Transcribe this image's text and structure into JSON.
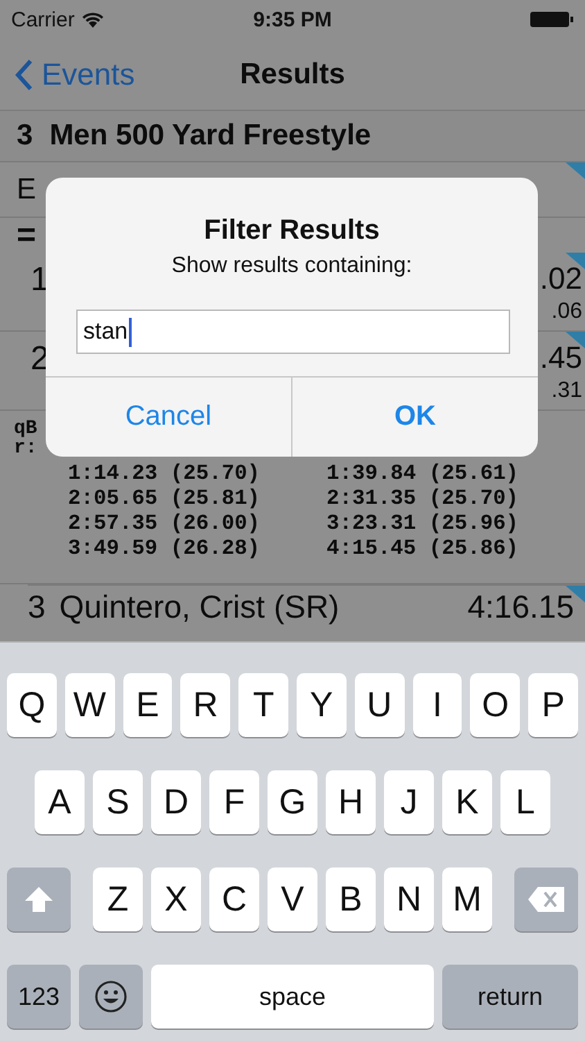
{
  "status_bar": {
    "carrier": "Carrier",
    "time": "9:35 PM"
  },
  "nav": {
    "back": "Events",
    "title": "Results"
  },
  "event_header": {
    "number": "3",
    "name": "Men 500 Yard Freestyle"
  },
  "list": [
    {
      "kind": "label",
      "text": "E",
      "flagged": true
    },
    {
      "kind": "separator",
      "text": "="
    },
    {
      "kind": "result",
      "place": "1",
      "time": ".02",
      "split": ".06",
      "flagged": true
    },
    {
      "kind": "result",
      "place": "2",
      "time": ".45",
      "split": ".31",
      "flagged": true
    },
    {
      "kind": "code",
      "lines": [
        "qB",
        "r:"
      ]
    },
    {
      "kind": "splits",
      "rows": [
        [
          "1:14.23 (25.70)",
          "1:39.84 (25.61)"
        ],
        [
          "2:05.65 (25.81)",
          "2:31.35 (25.70)"
        ],
        [
          "2:57.35 (26.00)",
          "3:23.31 (25.96)"
        ],
        [
          "3:49.59 (26.28)",
          "4:15.45 (25.86)"
        ]
      ]
    },
    {
      "kind": "athlete",
      "place": "3",
      "name": "Quintero, Crist (SR)",
      "time": "4:16.15",
      "flagged": true
    }
  ],
  "dialog": {
    "title": "Filter Results",
    "message": "Show results containing:",
    "value": "stan",
    "buttons": [
      {
        "label": "Cancel",
        "kind": "cancel"
      },
      {
        "label": "OK",
        "kind": "default"
      }
    ]
  },
  "keyboard": {
    "rows": [
      [
        {
          "kind": "letter",
          "label": "Q"
        },
        {
          "kind": "letter",
          "label": "W"
        },
        {
          "kind": "letter",
          "label": "E"
        },
        {
          "kind": "letter",
          "label": "R"
        },
        {
          "kind": "letter",
          "label": "T"
        },
        {
          "kind": "letter",
          "label": "Y"
        },
        {
          "kind": "letter",
          "label": "U"
        },
        {
          "kind": "letter",
          "label": "I"
        },
        {
          "kind": "letter",
          "label": "O"
        },
        {
          "kind": "letter",
          "label": "P"
        }
      ],
      [
        {
          "kind": "letter",
          "label": "A"
        },
        {
          "kind": "letter",
          "label": "S"
        },
        {
          "kind": "letter",
          "label": "D"
        },
        {
          "kind": "letter",
          "label": "F"
        },
        {
          "kind": "letter",
          "label": "G"
        },
        {
          "kind": "letter",
          "label": "H"
        },
        {
          "kind": "letter",
          "label": "J"
        },
        {
          "kind": "letter",
          "label": "K"
        },
        {
          "kind": "letter",
          "label": "L"
        }
      ],
      [
        {
          "kind": "shift"
        },
        {
          "kind": "letter",
          "label": "Z"
        },
        {
          "kind": "letter",
          "label": "X"
        },
        {
          "kind": "letter",
          "label": "C"
        },
        {
          "kind": "letter",
          "label": "V"
        },
        {
          "kind": "letter",
          "label": "B"
        },
        {
          "kind": "letter",
          "label": "N"
        },
        {
          "kind": "letter",
          "label": "M"
        },
        {
          "kind": "delete"
        }
      ]
    ],
    "bottom_bar": [
      {
        "kind": "mode",
        "label": "123"
      },
      {
        "kind": "emoji"
      },
      {
        "kind": "space",
        "label": "space"
      },
      {
        "kind": "return",
        "label": "return"
      }
    ]
  }
}
